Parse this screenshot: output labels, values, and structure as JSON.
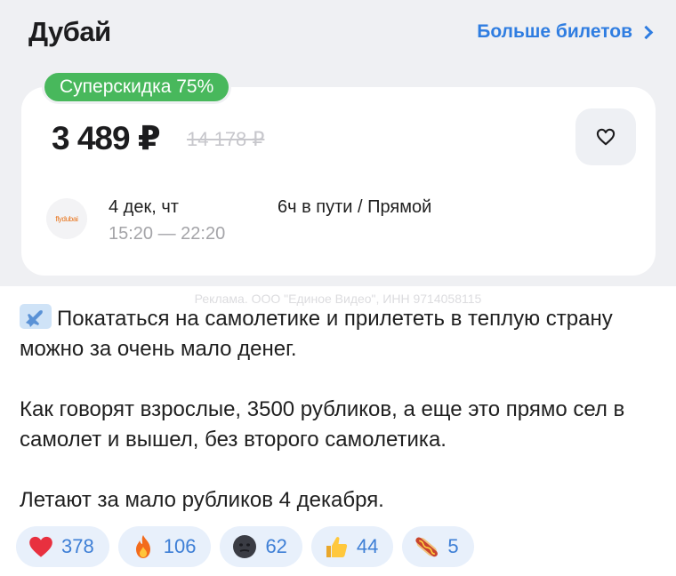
{
  "header": {
    "city": "Дубай",
    "more_link": "Больше билетов"
  },
  "ticket": {
    "badge": "Суперскидка 75%",
    "price": "3 489 ₽",
    "old_price": "14 178 ₽",
    "airline_logo_text": "flydubai",
    "date": "4 дек, чт",
    "time": "15:20 — 22:20",
    "duration": "6ч в пути / Прямой"
  },
  "ad_label": "Реклама. ООО \"Единое Видео\", ИНН 9714058115",
  "post": {
    "paragraph1": "Покататься на самолетике и прилететь в теплую страну можно за очень мало денег.",
    "paragraph2": "Как говорят взрослые, 3500 рубликов, а еще это прямо сел в самолет и вышел, без второго самолетика.",
    "paragraph3": "Летают за мало рубликов 4 декабря."
  },
  "reactions": [
    {
      "icon": "heart-icon",
      "count": "378"
    },
    {
      "icon": "fire-icon",
      "count": "106"
    },
    {
      "icon": "dark-face-icon",
      "count": "62"
    },
    {
      "icon": "thumbs-up-icon",
      "count": "44"
    },
    {
      "icon": "hotdog-icon",
      "count": "5"
    }
  ],
  "colors": {
    "accent": "#2f7de1",
    "badge": "#48b85c",
    "panel": "#eff0f3",
    "reaction_bg": "#e8f0fb"
  }
}
